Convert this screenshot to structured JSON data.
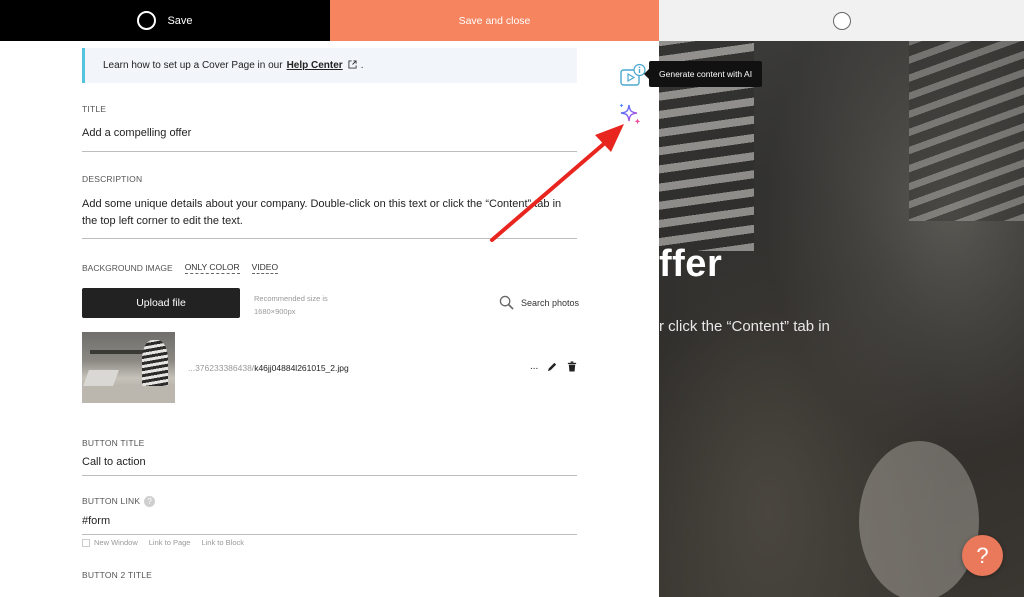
{
  "topbar": {
    "save_label": "Save",
    "save_close_label": "Save and close"
  },
  "info_banner": {
    "text_before": "Learn how to set up a Cover Page in our",
    "link_text": "Help Center",
    "text_after": "."
  },
  "title_field": {
    "label": "TITLE",
    "value": "Add a compelling offer"
  },
  "description_field": {
    "label": "DESCRIPTION",
    "value": "Add some unique details about your company. Double-click on this text or click the “Content” tab in the top left corner to edit the text."
  },
  "background": {
    "label": "BACKGROUND IMAGE",
    "tabs": [
      "ONLY COLOR",
      "VIDEO"
    ],
    "upload_label": "Upload file",
    "recommended_size": "Recommended size is 1680×900px",
    "search_photos_label": "Search photos",
    "file_prefix": "...376233386438/",
    "file_suffix": "k46jj04884l261015_2.jpg",
    "more_label": "..."
  },
  "button_title_field": {
    "label": "BUTTON TITLE",
    "value": "Call to action"
  },
  "button_link_field": {
    "label": "BUTTON LINK",
    "value": "#form",
    "options": [
      "New Window",
      "Link to Page",
      "Link to Block"
    ]
  },
  "button2_title_field": {
    "label": "BUTTON 2 TITLE"
  },
  "ai_tooltip": "Generate content with AI",
  "preview": {
    "title_fragment": "ffer",
    "desc_fragment": "r click the “Content” tab in"
  },
  "help_button_label": "?",
  "colors": {
    "accent": "#f5845f",
    "banner_border": "#54c3de",
    "arrow": "#e8261f"
  },
  "icons": {
    "save": "circle-icon",
    "ai": "sparkles-icon",
    "video_info": "video-info-icon",
    "search": "search-icon",
    "edit": "pencil-icon",
    "delete": "trash-icon",
    "external": "external-link-icon"
  }
}
